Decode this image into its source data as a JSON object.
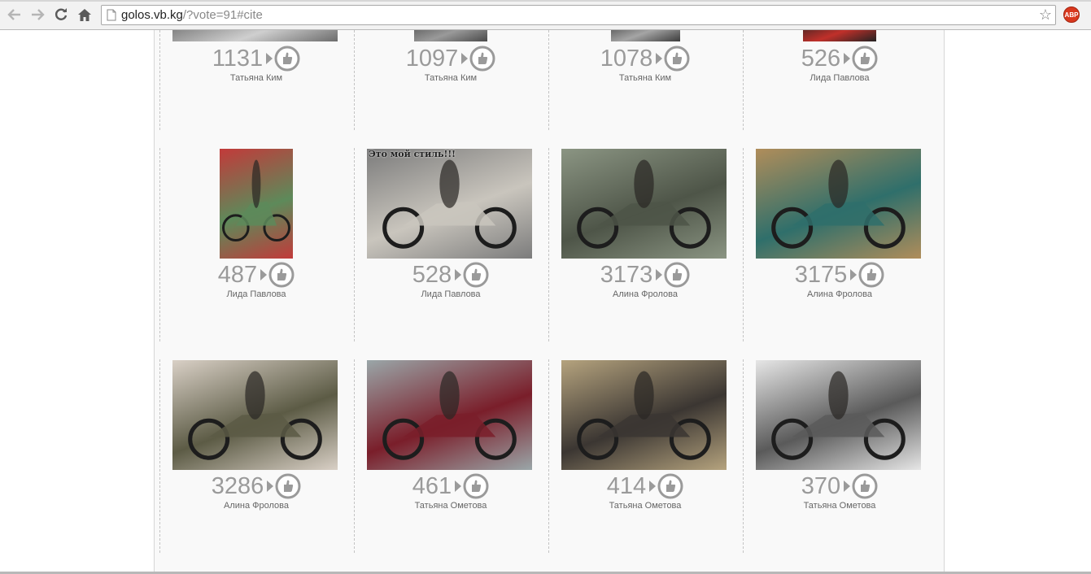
{
  "browser": {
    "url_host": "golos.vb.kg",
    "url_rest": "/?vote=91#cite",
    "back_icon": "back-arrow-icon",
    "forward_icon": "forward-arrow-icon",
    "reload_icon": "reload-icon",
    "home_icon": "home-icon",
    "bookmark_icon": "star-icon",
    "extension_label": "ABP"
  },
  "rows": [
    {
      "items": [
        {
          "votes": "1131",
          "author": "Татьяна Ким",
          "colors": [
            "#6c6c6c",
            "#cfcfcf"
          ]
        },
        {
          "votes": "1097",
          "author": "Татьяна Ким",
          "colors": [
            "#4a4a4a",
            "#9a9a9a"
          ]
        },
        {
          "votes": "1078",
          "author": "Татьяна Ким",
          "colors": [
            "#3b3b3b",
            "#a5a5a5"
          ]
        },
        {
          "votes": "526",
          "author": "Лида Павлова",
          "colors": [
            "#222222",
            "#c0302a"
          ]
        }
      ]
    },
    {
      "items": [
        {
          "votes": "487",
          "author": "Лида Павлова",
          "colors": [
            "#c23a3a",
            "#5d8a5a"
          ],
          "caption": ""
        },
        {
          "votes": "528",
          "author": "Лида Павлова",
          "colors": [
            "#7c7c7c",
            "#c9c5bd"
          ],
          "caption": "Это мой стиль!!!"
        },
        {
          "votes": "3173",
          "author": "Алина Фролова",
          "colors": [
            "#8b9583",
            "#4e5548"
          ]
        },
        {
          "votes": "3175",
          "author": "Алина Фролова",
          "colors": [
            "#b08d5a",
            "#2f6f6b"
          ]
        }
      ]
    },
    {
      "items": [
        {
          "votes": "3286",
          "author": "Алина Фролова",
          "colors": [
            "#d9d0c6",
            "#5c5b45"
          ]
        },
        {
          "votes": "461",
          "author": "Татьяна Ометова",
          "colors": [
            "#9aa6a8",
            "#7a1e2a"
          ]
        },
        {
          "votes": "414",
          "author": "Татьяна Ометова",
          "colors": [
            "#b5a37e",
            "#3b3632"
          ]
        },
        {
          "votes": "370",
          "author": "Татьяна Ометова",
          "colors": [
            "#e6e6e6",
            "#5a5a5a"
          ]
        }
      ]
    }
  ]
}
